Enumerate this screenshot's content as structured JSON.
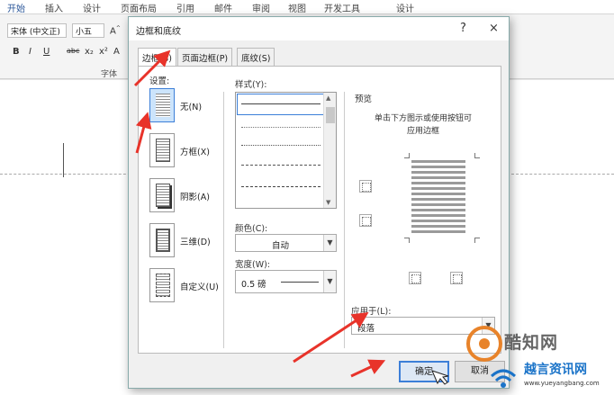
{
  "ribbon": {
    "tabs": [
      "开始",
      "插入",
      "设计",
      "页面布局",
      "引用",
      "邮件",
      "审阅",
      "视图",
      "开发工具",
      "设计"
    ],
    "font_name": "宋体 (中文正)",
    "font_size": "小五",
    "format_buttons": [
      "B",
      "I",
      "U",
      "abc",
      "x₂",
      "x²",
      "A"
    ],
    "group_label": "字体"
  },
  "dialog": {
    "title": "边框和底纹",
    "help": "?",
    "close": "×",
    "tabs": [
      "边框(B)",
      "页面边框(P)",
      "底纹(S)"
    ],
    "setting_label": "设置:",
    "settings": [
      "无(N)",
      "方框(X)",
      "阴影(A)",
      "三维(D)",
      "自定义(U)"
    ],
    "style_label": "样式(Y):",
    "color_label": "颜色(C):",
    "color_value": "自动",
    "width_label": "宽度(W):",
    "width_value": "0.5 磅",
    "preview_label": "预览",
    "preview_desc_1": "单击下方图示或使用按钮可",
    "preview_desc_2": "应用边框",
    "apply_label": "应用于(L):",
    "apply_value": "段落",
    "ok": "确定",
    "cancel": "取消"
  },
  "watermark": {
    "line1": "酷知网",
    "line2": "越言资讯网",
    "url": "www.yueyangbang.com"
  },
  "colors": {
    "accent": "#2b579a",
    "annotation": "#e8332a",
    "selection": "#3c7fd8"
  }
}
